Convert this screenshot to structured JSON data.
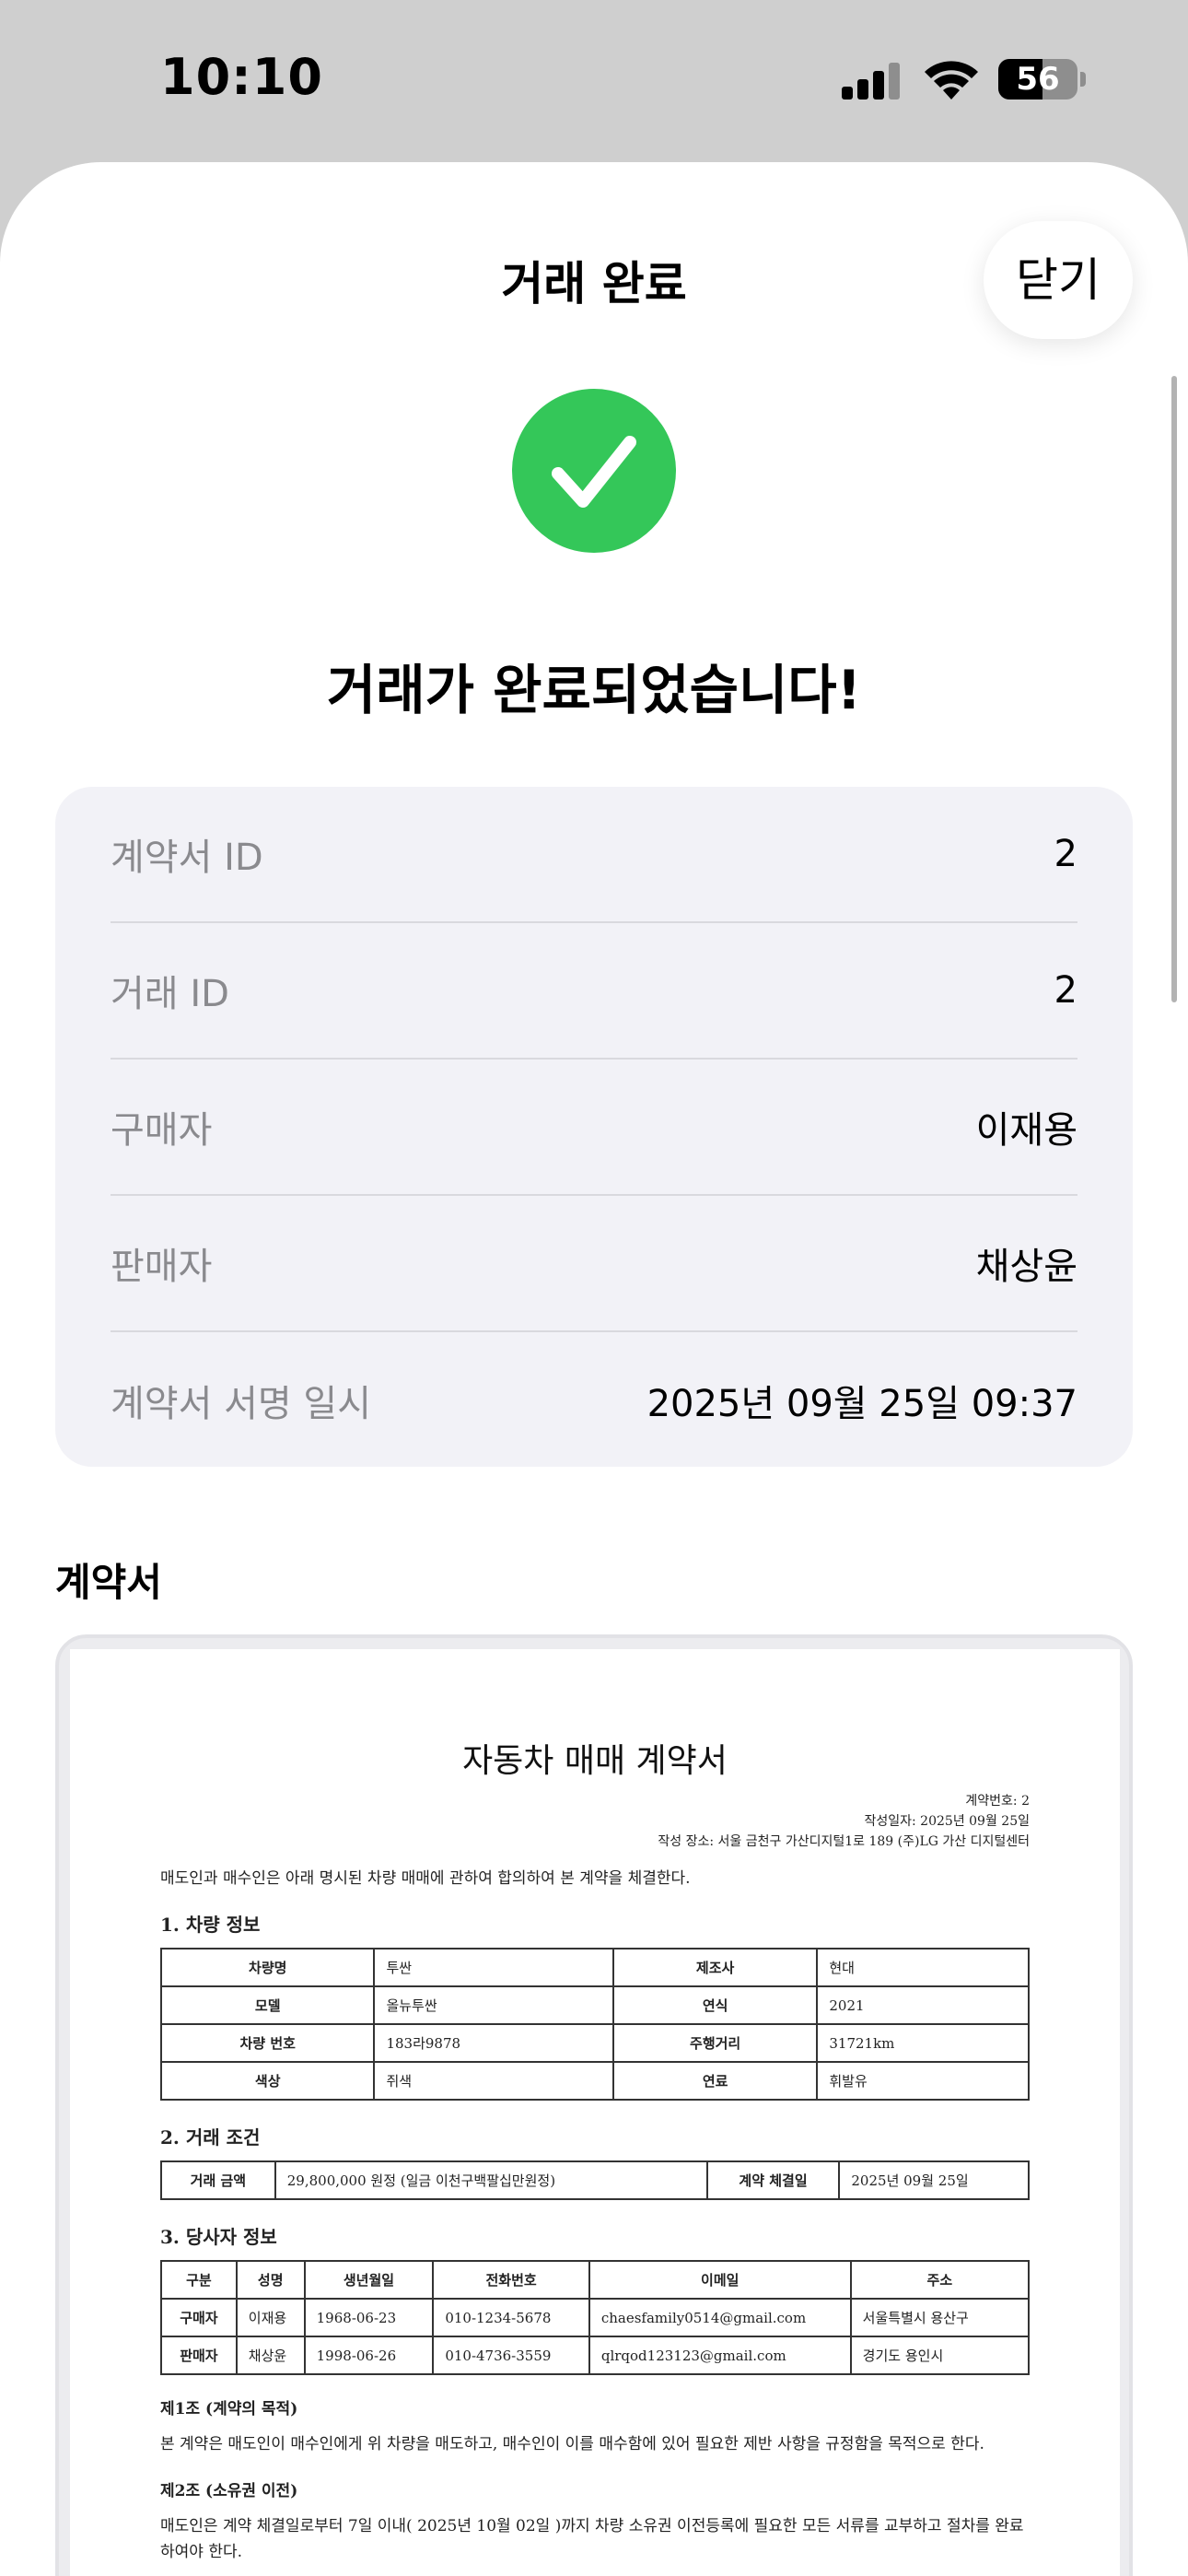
{
  "status_bar": {
    "time": "10:10",
    "battery_percent": 56,
    "battery_label": "56",
    "signal_bars_active": 3,
    "signal_bars_total": 4
  },
  "header": {
    "title": "거래 완료",
    "close_label": "닫기"
  },
  "colors": {
    "success": "#34c759",
    "card_background": "#f2f2f7",
    "label_gray": "#8a8a8e"
  },
  "success": {
    "icon": "checkmark-circle-icon",
    "message": "거래가 완료되었습니다!"
  },
  "info": {
    "rows": [
      {
        "label": "계약서 ID",
        "value": "2"
      },
      {
        "label": "거래 ID",
        "value": "2"
      },
      {
        "label": "구매자",
        "value": "이재용"
      },
      {
        "label": "판매자",
        "value": "채상윤"
      },
      {
        "label": "계약서 서명 일시",
        "value": "2025년 09월 25일 09:37"
      }
    ]
  },
  "contract_section": {
    "title": "계약서"
  },
  "document": {
    "title": "자동차 매매 계약서",
    "meta": [
      "계약번호: 2",
      "작성일자: 2025년 09월 25일",
      "작성 장소: 서울 금천구 가산디지털1로 189 (주)LG 가산 디지털센터"
    ],
    "intro": "매도인과 매수인은 아래 명시된 차량 매매에 관하여 합의하여 본 계약을 체결한다.",
    "vehicle": {
      "heading": "1. 차량 정보",
      "rows": [
        [
          "차량명",
          "투싼",
          "제조사",
          "현대"
        ],
        [
          "모델",
          "올뉴투싼",
          "연식",
          "2021"
        ],
        [
          "차량 번호",
          "183라9878",
          "주행거리",
          "31721km"
        ],
        [
          "색상",
          "쥐색",
          "연료",
          "휘발유"
        ]
      ]
    },
    "terms": {
      "heading": "2. 거래 조건",
      "price_label": "거래 금액",
      "price_value": "29,800,000 원정 (일금 이천구백팔십만원정)",
      "date_label": "계약 체결일",
      "date_value": "2025년 09월 25일"
    },
    "parties": {
      "heading": "3. 당사자 정보",
      "columns": [
        "구분",
        "성명",
        "생년월일",
        "전화번호",
        "이메일",
        "주소"
      ],
      "rows": [
        [
          "구매자",
          "이재용",
          "1968-06-23",
          "010-1234-5678",
          "chaesfamily0514@gmail.com",
          "서울특별시 용산구"
        ],
        [
          "판매자",
          "채상윤",
          "1998-06-26",
          "010-4736-3559",
          "qlrqod123123@gmail.com",
          "경기도 용인시"
        ]
      ]
    },
    "articles": [
      {
        "title": "제1조 (계약의 목적)",
        "body": "본 계약은 매도인이 매수인에게 위 차량을 매도하고, 매수인이 이를 매수함에 있어 필요한 제반 사항을 규정함을 목적으로 한다."
      },
      {
        "title": "제2조 (소유권 이전)",
        "body": "매도인은 계약 체결일로부터 7일 이내( 2025년 10월 02일 )까지 차량 소유권 이전등록에 필요한 모든 서류를 교부하고 절차를 완료하여야 한다."
      }
    ]
  }
}
